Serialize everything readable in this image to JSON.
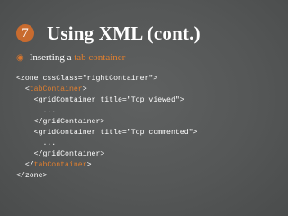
{
  "slide": {
    "number": "7",
    "title": "Using XML (cont.)",
    "bullet": {
      "prefix": "Inserting a ",
      "highlight": "tab container"
    },
    "code": [
      {
        "indent": "",
        "pre": "<zone cssClass=\"rightContainer\">",
        "hl": "",
        "post": ""
      },
      {
        "indent": "  ",
        "pre": "<",
        "hl": "tabContainer",
        "post": ">"
      },
      {
        "indent": "    ",
        "pre": "<gridContainer title=\"Top viewed\">",
        "hl": "",
        "post": ""
      },
      {
        "indent": "      ",
        "pre": "...",
        "hl": "",
        "post": ""
      },
      {
        "indent": "    ",
        "pre": "</gridContainer>",
        "hl": "",
        "post": ""
      },
      {
        "indent": "    ",
        "pre": "<gridContainer title=\"Top commented\">",
        "hl": "",
        "post": ""
      },
      {
        "indent": "      ",
        "pre": "...",
        "hl": "",
        "post": ""
      },
      {
        "indent": "    ",
        "pre": "</gridContainer>",
        "hl": "",
        "post": ""
      },
      {
        "indent": "  ",
        "pre": "</",
        "hl": "tabContainer",
        "post": ">"
      },
      {
        "indent": "",
        "pre": "</zone>",
        "hl": "",
        "post": ""
      }
    ]
  },
  "colors": {
    "background": "#555757",
    "accent": "#e07f2f",
    "badge": "#c86b2f",
    "text": "#ffffff"
  }
}
